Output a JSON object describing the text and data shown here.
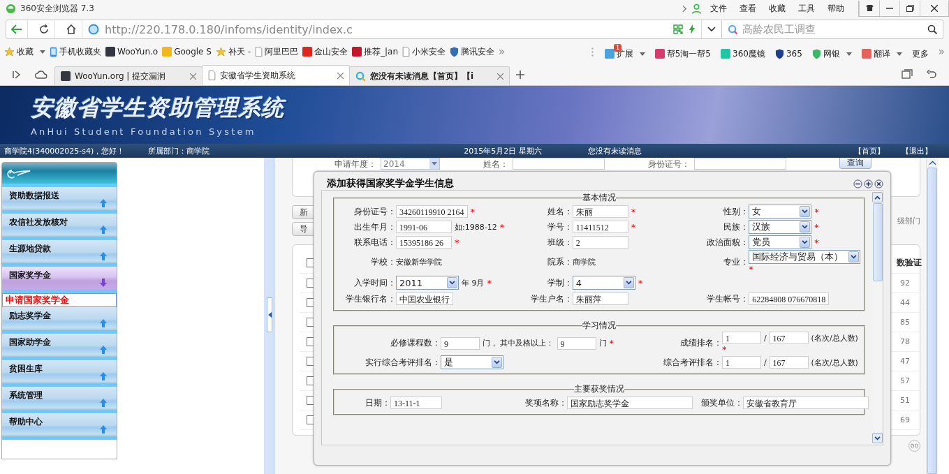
{
  "browser": {
    "title": "360安全浏览器 7.3",
    "menu": [
      "文件",
      "查看",
      "收藏",
      "工具",
      "帮助"
    ],
    "url": "http://220.178.0.180/infoms/identity/index.c",
    "search": {
      "placeholder": "高龄农民工调查"
    },
    "bookmarks": [
      {
        "label": "收藏",
        "kind": "star",
        "dropdown": true
      },
      {
        "label": "手机收藏夹",
        "kind": "phone",
        "dropdown": false
      },
      {
        "label": "WooYun.o",
        "kind": "square",
        "color": "#333840",
        "dropdown": false
      },
      {
        "label": "Google S",
        "kind": "square",
        "color": "#f2b71a",
        "dropdown": false
      },
      {
        "label": "补天 -",
        "kind": "star",
        "dropdown": false
      },
      {
        "label": "阿里巴巴",
        "kind": "page",
        "dropdown": false
      },
      {
        "label": "金山安全",
        "kind": "square",
        "color": "#e0261e",
        "dropdown": false
      },
      {
        "label": "推荐_|an",
        "kind": "square",
        "color": "#c4162a",
        "dropdown": false
      },
      {
        "label": "小米安全",
        "kind": "page",
        "dropdown": false
      },
      {
        "label": "腾讯安全",
        "kind": "shield",
        "color": "#2f6fb5",
        "dropdown": false
      }
    ],
    "bookmarks_more": "»",
    "extensions": [
      {
        "label": "扩展",
        "kind": "square",
        "color": "#4aa3df",
        "badge": "1",
        "dropdown": true
      },
      {
        "label": "帮5淘一帮5",
        "kind": "square",
        "color": "#d63b6f",
        "dropdown": false
      },
      {
        "label": "360魔镜",
        "kind": "square",
        "color": "#1ec8a5",
        "dropdown": false
      },
      {
        "label": "365",
        "kind": "shield",
        "color": "#1d3f8f",
        "dropdown": false
      },
      {
        "label": "网银",
        "kind": "shield",
        "color": "#3fb56a",
        "dropdown": true
      },
      {
        "label": "翻译",
        "kind": "square",
        "color": "#e8625c",
        "dropdown": true
      },
      {
        "label": "更多",
        "kind": "text",
        "dropdown": false
      }
    ],
    "extensions_more": "»",
    "tabs": [
      {
        "label": "WooYun.org | 提交漏洞",
        "kind": "square",
        "selected": false
      },
      {
        "label": "安徽省学生资助系统",
        "kind": "page",
        "selected": true
      },
      {
        "label": "您没有未读消息【首页】【i",
        "kind": "search",
        "selected": false
      }
    ]
  },
  "site": {
    "title": "安徽省学生资助管理系统",
    "subtitle": "AnHui Student Foundation System"
  },
  "userbar": {
    "greeting": "商学院4(340002025-s4)，您好！",
    "department": "所属部门：商学院",
    "date": "2015年5月2日 星期六",
    "messages": "您没有未读消息",
    "links": [
      "【首页】",
      "【退出】"
    ]
  },
  "sidebar": [
    {
      "label": "资助数据报送",
      "expanded": false
    },
    {
      "label": "农信社发放核对",
      "expanded": false
    },
    {
      "label": "生源地贷款",
      "expanded": false
    },
    {
      "label": "国家奖学金",
      "expanded": true,
      "children": [
        {
          "label": "申请国家奖学金",
          "selected": true
        }
      ]
    },
    {
      "label": "励志奖学金",
      "expanded": false
    },
    {
      "label": "国家助学金",
      "expanded": false
    },
    {
      "label": "贫困生库",
      "expanded": false
    },
    {
      "label": "系统管理",
      "expanded": false
    },
    {
      "label": "帮助中心",
      "expanded": false
    }
  ],
  "filters": {
    "year_label": "申请年度：",
    "year": "2014",
    "name_label": "姓名：",
    "id_label": "身份证号：",
    "query": "查询"
  },
  "actions": [
    "新",
    "导"
  ],
  "dept_text": "级部门",
  "table": {
    "header_checked": false,
    "column_header": "数验证",
    "rows": [
      {
        "checked": false,
        "value": "92"
      },
      {
        "checked": false,
        "value": "44"
      },
      {
        "checked": false,
        "value": "85"
      },
      {
        "checked": false,
        "value": "78"
      },
      {
        "checked": false,
        "value": "47"
      },
      {
        "checked": false,
        "value": "57"
      },
      {
        "checked": false,
        "value": "51"
      },
      {
        "checked": false,
        "value": "69"
      }
    ]
  },
  "pager": {
    "go": "GO"
  },
  "dialog": {
    "title": "添加获得国家奖学金学生信息",
    "sections": [
      {
        "legend": "基本情况",
        "rows": [
          [
            {
              "label": "身份证号：",
              "parts": [
                {
                  "kind": "input",
                  "value": "34260119910 2164"
                },
                {
                  "kind": "mark",
                  "text": "*"
                }
              ]
            },
            {
              "label": "姓名：",
              "parts": [
                {
                  "kind": "input",
                  "value": "朱丽"
                },
                {
                  "kind": "mark",
                  "text": "*"
                }
              ]
            },
            {
              "label": "性别：",
              "parts": [
                {
                  "kind": "select",
                  "value": "女"
                },
                {
                  "kind": "mark",
                  "text": "*"
                }
              ]
            }
          ],
          [
            {
              "label": "出生年月：",
              "parts": [
                {
                  "kind": "input",
                  "value": "1991-06"
                },
                {
                  "kind": "text",
                  "text": "如:1988-12"
                },
                {
                  "kind": "mark",
                  "text": "*"
                }
              ]
            },
            {
              "label": "学号：",
              "parts": [
                {
                  "kind": "input",
                  "value": "11411512"
                },
                {
                  "kind": "mark",
                  "text": "*"
                }
              ]
            },
            {
              "label": "民族：",
              "parts": [
                {
                  "kind": "select",
                  "value": "汉族"
                },
                {
                  "kind": "mark",
                  "text": "*"
                }
              ]
            }
          ],
          [
            {
              "label": "联系电话：",
              "parts": [
                {
                  "kind": "input",
                  "value": "15395186 26"
                },
                {
                  "kind": "mark",
                  "text": "*"
                }
              ]
            },
            {
              "label": "班级：",
              "parts": [
                {
                  "kind": "input",
                  "value": "2"
                }
              ]
            },
            {
              "label": "政治面貌：",
              "parts": [
                {
                  "kind": "select",
                  "value": "党员"
                },
                {
                  "kind": "mark",
                  "text": "*"
                }
              ]
            }
          ],
          [
            {
              "label": "学校：",
              "parts": [
                {
                  "kind": "text",
                  "text": "安徽新华学院"
                }
              ]
            },
            {
              "label": "院系：",
              "parts": [
                {
                  "kind": "text",
                  "text": "商学院"
                }
              ]
            },
            {
              "label": "专业：",
              "parts": [
                {
                  "kind": "select",
                  "value": "国际经济与贸易（本）"
                },
                {
                  "kind": "mark",
                  "text": "*"
                }
              ]
            }
          ],
          [
            {
              "label": "入学时间：",
              "parts": [
                {
                  "kind": "select",
                  "value": "2011"
                },
                {
                  "kind": "text",
                  "text": "年 9月"
                },
                {
                  "kind": "mark",
                  "text": "*"
                }
              ]
            },
            {
              "label": "学制：",
              "parts": [
                {
                  "kind": "select",
                  "value": "4"
                },
                {
                  "kind": "mark",
                  "text": "*"
                }
              ]
            }
          ],
          [
            {
              "label": "学生银行名：",
              "parts": [
                {
                  "kind": "input",
                  "value": "中国农业银行"
                }
              ]
            },
            {
              "label": "学生户名：",
              "parts": [
                {
                  "kind": "input",
                  "value": "朱丽萍"
                }
              ]
            },
            {
              "label": "学生帐号：",
              "parts": [
                {
                  "kind": "input",
                  "value": "62284808 076670818"
                }
              ]
            }
          ]
        ]
      },
      {
        "legend": "学习情况",
        "rows": [
          [
            {
              "label": "必修课程数：",
              "parts": [
                {
                  "kind": "input",
                  "value": "9"
                },
                {
                  "kind": "text",
                  "text": "门， 其中及格以上："
                },
                {
                  "kind": "input",
                  "value": "9"
                },
                {
                  "kind": "text",
                  "text": "门"
                },
                {
                  "kind": "mark",
                  "text": "*"
                }
              ]
            },
            {
              "label": "成绩排名：",
              "parts": [
                {
                  "kind": "input",
                  "value": "1"
                },
                {
                  "kind": "text",
                  "text": "/"
                },
                {
                  "kind": "input",
                  "value": "167"
                },
                {
                  "kind": "text",
                  "text": "(名次/总人数)"
                },
                {
                  "kind": "mark",
                  "text": "*"
                }
              ]
            }
          ],
          [
            {
              "label": "实行综合考评排名：",
              "parts": [
                {
                  "kind": "select",
                  "value": "是"
                }
              ]
            },
            {
              "label": "综合考评排名：",
              "parts": [
                {
                  "kind": "input",
                  "value": "1"
                },
                {
                  "kind": "text",
                  "text": "/"
                },
                {
                  "kind": "input",
                  "value": "167"
                },
                {
                  "kind": "text",
                  "text": "(名次/总人数)"
                }
              ]
            }
          ]
        ]
      },
      {
        "legend": "主要获奖情况",
        "rows": [
          [
            {
              "label": "日期：",
              "parts": [
                {
                  "kind": "input",
                  "value": "13-11-1"
                }
              ]
            },
            {
              "label": "奖项名称：",
              "parts": [
                {
                  "kind": "input",
                  "value": "国家励志奖学金"
                }
              ]
            },
            {
              "label": "颁奖单位：",
              "parts": [
                {
                  "kind": "input",
                  "value": "安徽省教育厅"
                }
              ]
            }
          ]
        ]
      }
    ]
  }
}
